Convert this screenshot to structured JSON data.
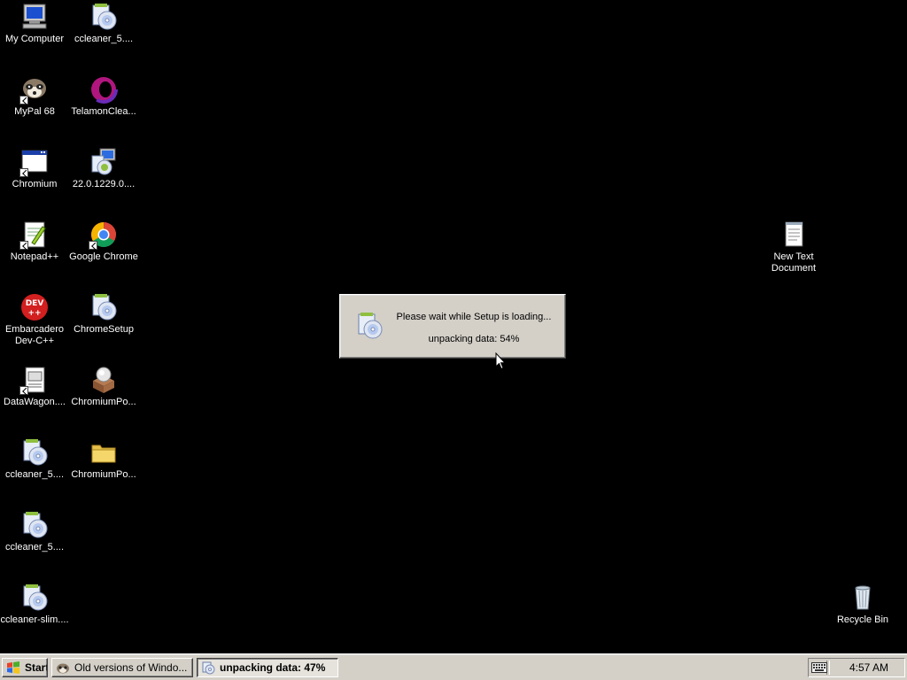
{
  "desktop": {
    "icons": [
      {
        "label": "My Computer",
        "icon": "my-computer-icon"
      },
      {
        "label": "ccleaner_5....",
        "icon": "installer-disc-icon"
      },
      {
        "label": "MyPal 68",
        "icon": "raccoon-browser-icon"
      },
      {
        "label": "TelamonClea...",
        "icon": "purple-ring-icon"
      },
      {
        "label": "Chromium",
        "icon": "application-window-icon"
      },
      {
        "label": "22.0.1229.0....",
        "icon": "setup-computer-icon"
      },
      {
        "label": "Notepad++",
        "icon": "notepad-plus-plus-icon"
      },
      {
        "label": "Google Chrome",
        "icon": "chrome-icon"
      },
      {
        "label": "Embarcadero Dev-C++",
        "icon": "dev-cpp-icon"
      },
      {
        "label": "ChromeSetup",
        "icon": "installer-disc-icon"
      },
      {
        "label": "DataWagon....",
        "icon": "document-shortcut-icon"
      },
      {
        "label": "ChromiumPo...",
        "icon": "package-box-icon"
      },
      {
        "label": "ccleaner_5....",
        "icon": "installer-disc-icon"
      },
      {
        "label": "ChromiumPo...",
        "icon": "folder-icon"
      },
      {
        "label": "ccleaner_5....",
        "icon": "installer-disc-icon"
      },
      {
        "label": "ccleaner-slim....",
        "icon": "installer-disc-icon"
      },
      {
        "label": "New Text Document",
        "icon": "text-document-icon"
      },
      {
        "label": "Recycle Bin",
        "icon": "recycle-bin-icon"
      }
    ]
  },
  "dialog": {
    "line1": "Please wait while Setup is loading...",
    "line2": "unpacking data: 54%",
    "icon": "installer-disc-icon"
  },
  "taskbar": {
    "start_label": "Start",
    "tasks": [
      {
        "label": "Old versions of Windo...",
        "icon": "browser-icon",
        "active": false
      },
      {
        "label": "unpacking data: 47%",
        "icon": "installer-disc-icon",
        "active": true
      }
    ],
    "tray_chevron": "«",
    "clock": "4:57 AM"
  },
  "colors": {
    "desktop_background": "#000000",
    "taskbar": "#d4d0c8",
    "icon_text": "#ffffff"
  }
}
